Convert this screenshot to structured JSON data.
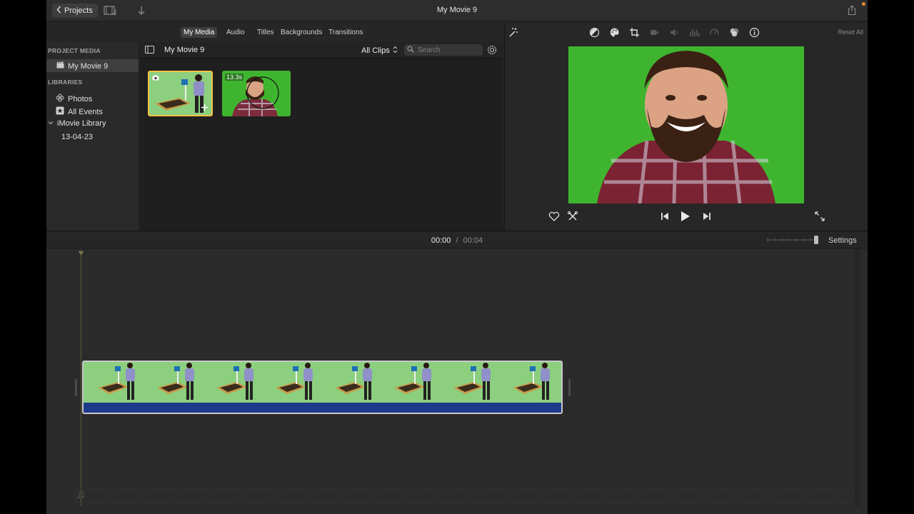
{
  "titlebar": {
    "back_label": "Projects",
    "title": "My Movie 9",
    "icons": [
      "media-browser-icon",
      "import-arrow-icon",
      "share-icon"
    ]
  },
  "browser_tabs": [
    {
      "label": "My Media",
      "active": true
    },
    {
      "label": "Audio",
      "active": false
    },
    {
      "label": "Titles",
      "active": false
    },
    {
      "label": "Backgrounds",
      "active": false
    },
    {
      "label": "Transitions",
      "active": false
    }
  ],
  "sidebar": {
    "project_media_header": "PROJECT MEDIA",
    "project_item": "My Movie 9",
    "libraries_header": "LIBRARIES",
    "photos": "Photos",
    "all_events": "All Events",
    "library_name": "iMovie Library",
    "event_date": "13-04-23"
  },
  "browser": {
    "title": "My Movie 9",
    "filter": "All Clips",
    "search_placeholder": "Search",
    "clips": [
      {
        "type": "photo",
        "duration": ""
      },
      {
        "type": "video",
        "duration": "13.3s"
      }
    ]
  },
  "viewer": {
    "reset_all": "Reset All",
    "adjust_icons": [
      "magic-wand-icon",
      "color-balance-icon",
      "color-palette-icon",
      "crop-icon",
      "stabilization-icon",
      "volume-icon",
      "equalizer-icon",
      "speed-icon",
      "clip-filter-icon",
      "info-icon"
    ]
  },
  "timeline": {
    "current_time": "00:00",
    "separator": "/",
    "total_time": "00:04",
    "settings_label": "Settings",
    "zoom_level": 1.0,
    "clip_frames": 8
  },
  "colors": {
    "selection": "#f6c342",
    "green_screen": "#3fb52f",
    "audio_bar": "#1e3a8a",
    "accent_dot": "#e48a2b"
  }
}
